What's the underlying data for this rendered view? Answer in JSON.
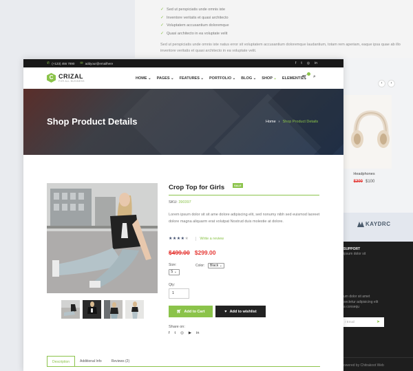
{
  "background": {
    "list": [
      "Sed ut perspiciatis unde omnis iste",
      "Inventore veritatis et quasi architecto",
      "Voluptatem accusantium doloremque",
      "Quasi architecto in ea voluptate velit"
    ],
    "paragraph": "Sed ut perspiciatis unde omnis iste natus error sit voluptatem accusantium doloremque laudantium, totam rem aperiam, eaque ipsa quae ab illo inventore veritatis et quasi architecto in ea voluptate velit.",
    "product": {
      "name": "Headphones",
      "old_price": "$200",
      "new_price": "$100"
    },
    "brand": "KAYDRC",
    "support_title": "SUPPORT",
    "support_text": "ipsum dolor sit",
    "newsletter_text": "um dolor sit amet\nsectetur adipisicing elit\na consequ",
    "subscribe_placeholder": "r Email",
    "copyright": "owered by Chitrakoot Web"
  },
  "topbar": {
    "phone": "(+123) 456 7890",
    "email": "addyour@emailhere"
  },
  "brand": {
    "name": "CRIZAL",
    "tagline": "FOR ALL BUSINESS",
    "mark": "C"
  },
  "menu": [
    "HOME",
    "PAGES",
    "FEATURES",
    "PORTFOLIO",
    "BLOG",
    "SHOP",
    "ELEMENTS"
  ],
  "hero": {
    "title": "Shop Product Details",
    "crumb_home": "Home",
    "crumb_current": "Shop Product Details"
  },
  "product": {
    "title": "Crop Top for Girls",
    "badge": "SALE",
    "sku_label": "SKU:",
    "sku": "390397",
    "description": "Lorem ipsum dolor sit sit ame dolore adipiscing elit, sed nonumy nibh sed euismod laoreet dolore magna aliquarm erat volutpat Nostrud duis molestie at dolore.",
    "rating": 4,
    "review_link": "Write a review",
    "old_price": "$499.00",
    "price": "$299.00",
    "size_label": "Size:",
    "size_value": "S",
    "color_label": "Color:",
    "color_value": "Black",
    "qty_label": "Qty:",
    "qty_value": "1",
    "add_to_cart": "Add to Cart",
    "add_to_wishlist": "Add to wishlist",
    "share_label": "Share on:"
  },
  "tabs": [
    "Description",
    "Additional Info",
    "Reviews (2)"
  ],
  "colors": {
    "accent": "#8bc34a",
    "dark": "#181818",
    "price": "#e53935"
  }
}
